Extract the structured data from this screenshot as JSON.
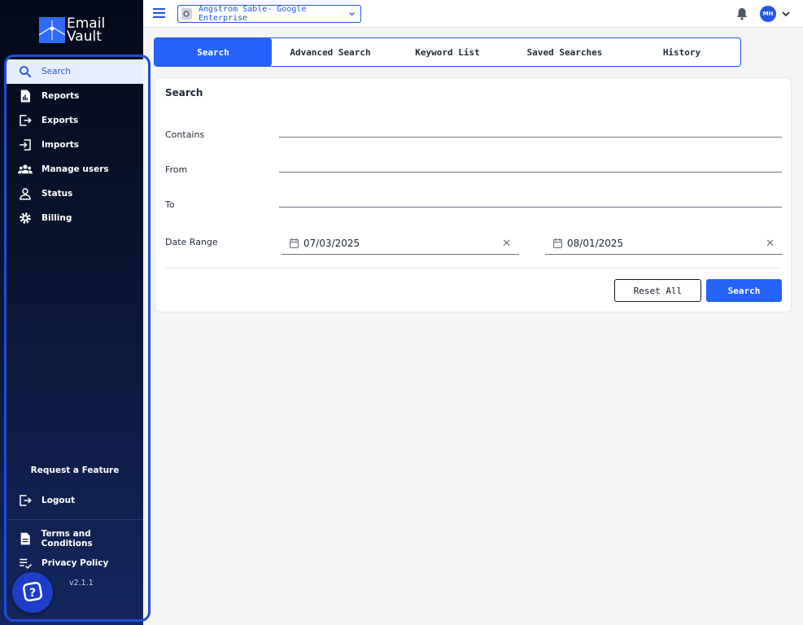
{
  "brand": {
    "line1": "Email",
    "line2": "Vault",
    "icon": "email-vault-logo"
  },
  "sidebar": {
    "items": [
      {
        "label": "Search",
        "icon": "search-icon",
        "active": true
      },
      {
        "label": "Reports",
        "icon": "report-icon"
      },
      {
        "label": "Exports",
        "icon": "export-icon"
      },
      {
        "label": "Imports",
        "icon": "import-icon"
      },
      {
        "label": "Manage users",
        "icon": "users-icon"
      },
      {
        "label": "Status",
        "icon": "person-icon"
      },
      {
        "label": "Billing",
        "icon": "gear-icon"
      }
    ],
    "request_feature": "Request a Feature",
    "logout": "Logout",
    "terms": "Terms and Conditions",
    "privacy": "Privacy Policy",
    "version": "v2.1.1"
  },
  "topbar": {
    "tenant": "Angstrom Sable- Google Enterprise",
    "avatar_initials": "MH"
  },
  "tabs": [
    {
      "label": "Search",
      "active": true
    },
    {
      "label": "Advanced Search"
    },
    {
      "label": "Keyword List"
    },
    {
      "label": "Saved Searches"
    },
    {
      "label": "History"
    }
  ],
  "search_form": {
    "title": "Search",
    "contains_label": "Contains",
    "contains_value": "",
    "from_label": "From",
    "from_value": "",
    "to_label": "To",
    "to_value": "",
    "date_range_label": "Date Range",
    "start_date": "07/03/2025",
    "end_date": "08/01/2025",
    "clear_symbol": "✕",
    "reset_label": "Reset All",
    "search_label": "Search"
  },
  "colors": {
    "accent": "#2563fb",
    "sidebar_top": "#050a1a",
    "sidebar_bottom": "#14275e"
  }
}
